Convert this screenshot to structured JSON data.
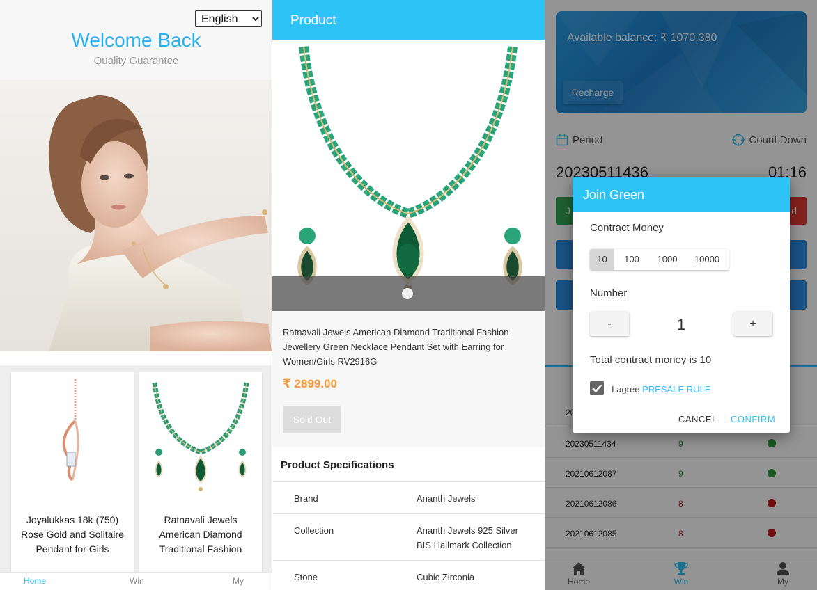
{
  "home": {
    "language": "English",
    "language_options": [
      "English"
    ],
    "welcome": "Welcome Back",
    "tagline": "Quality Guarantee",
    "products": [
      {
        "name": "Joyalukkas 18k (750) Rose Gold and Solitaire Pendant for Girls"
      },
      {
        "name": "Ratnavali Jewels American Diamond Traditional Fashion"
      }
    ],
    "tabs": [
      {
        "label": "Home",
        "active": true
      },
      {
        "label": "Win",
        "active": false
      },
      {
        "label": "My",
        "active": false
      }
    ]
  },
  "product": {
    "header_title": "Product",
    "name": "Ratnavali Jewels American Diamond Traditional Fashion Jewellery Green Necklace Pendant Set with Earring for Women/Girls RV2916G",
    "price": "₹ 2899.00",
    "sold_out_label": "Sold Out",
    "specs_title": "Product Specifications",
    "specs": [
      {
        "key": "Brand",
        "value": "Ananth Jewels"
      },
      {
        "key": "Collection",
        "value": "Ananth Jewels 925 Silver BIS Hallmark Collection"
      },
      {
        "key": "Stone",
        "value": "Cubic Zirconia"
      }
    ]
  },
  "win": {
    "balance_text": "Available balance: ₹ 1070.380",
    "recharge_label": "Recharge",
    "period_label": "Period",
    "countdown_label": "Count Down",
    "period_number": "20230511436",
    "timer": "01:16",
    "join_green_partial": "J",
    "join_red_partial": "d",
    "history": [
      {
        "period": "20",
        "number": "",
        "color": ""
      },
      {
        "period": "20230511434",
        "number": "9",
        "color": "#2e9b3a"
      },
      {
        "period": "20210612087",
        "number": "9",
        "color": "#2e9b3a"
      },
      {
        "period": "20210612086",
        "number": "8",
        "color": "#c0181a"
      },
      {
        "period": "20210612085",
        "number": "8",
        "color": "#c0181a"
      }
    ],
    "tabs": [
      {
        "label": "Home",
        "icon": "home-icon",
        "active": false
      },
      {
        "label": "Win",
        "icon": "trophy-icon",
        "active": true
      },
      {
        "label": "My",
        "icon": "user-icon",
        "active": false
      }
    ],
    "dialog": {
      "title": "Join Green",
      "contract_label": "Contract Money",
      "amounts": [
        "10",
        "100",
        "1000",
        "10000"
      ],
      "selected_amount": "10",
      "number_label": "Number",
      "minus": "-",
      "plus": "+",
      "quantity": "1",
      "total_text": "Total contract money is 10",
      "agree_prefix": "I agree",
      "agree_link": "PRESALE RULE",
      "agreed": true,
      "cancel": "CANCEL",
      "confirm": "CONFIRM"
    }
  },
  "colors": {
    "accent": "#2ec3f6",
    "welcome": "#2ab0f0",
    "price": "#f39a3d",
    "green": "#34a853",
    "red": "#e53935"
  }
}
